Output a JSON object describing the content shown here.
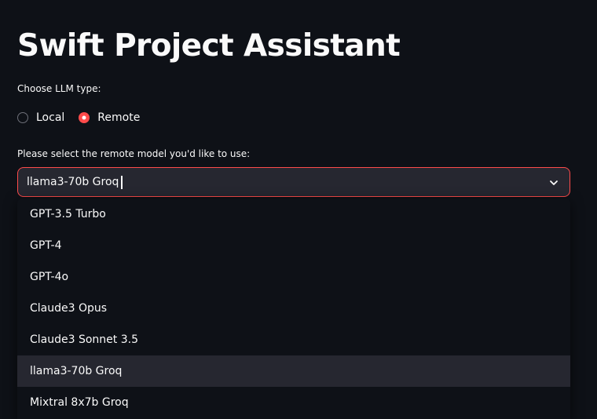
{
  "page": {
    "title": "Swift Project Assistant"
  },
  "llm_type": {
    "label": "Choose LLM type:",
    "options": [
      {
        "label": "Local",
        "checked": false
      },
      {
        "label": "Remote",
        "checked": true
      }
    ]
  },
  "remote_model": {
    "label": "Please select the remote model you'd like to use:",
    "selected": "llama3-70b Groq",
    "chevron_icon": "chevron-down-icon",
    "options": [
      {
        "label": "GPT-3.5 Turbo",
        "highlighted": false
      },
      {
        "label": "GPT-4",
        "highlighted": false
      },
      {
        "label": "GPT-4o",
        "highlighted": false
      },
      {
        "label": "Claude3 Opus",
        "highlighted": false
      },
      {
        "label": "Claude3 Sonnet 3.5",
        "highlighted": false
      },
      {
        "label": "llama3-70b Groq",
        "highlighted": true
      },
      {
        "label": "Mixtral 8x7b Groq",
        "highlighted": false
      }
    ]
  },
  "colors": {
    "background": "#0e1117",
    "accent": "#ff4b4b",
    "input_background": "#262730",
    "text": "#fafafa"
  }
}
